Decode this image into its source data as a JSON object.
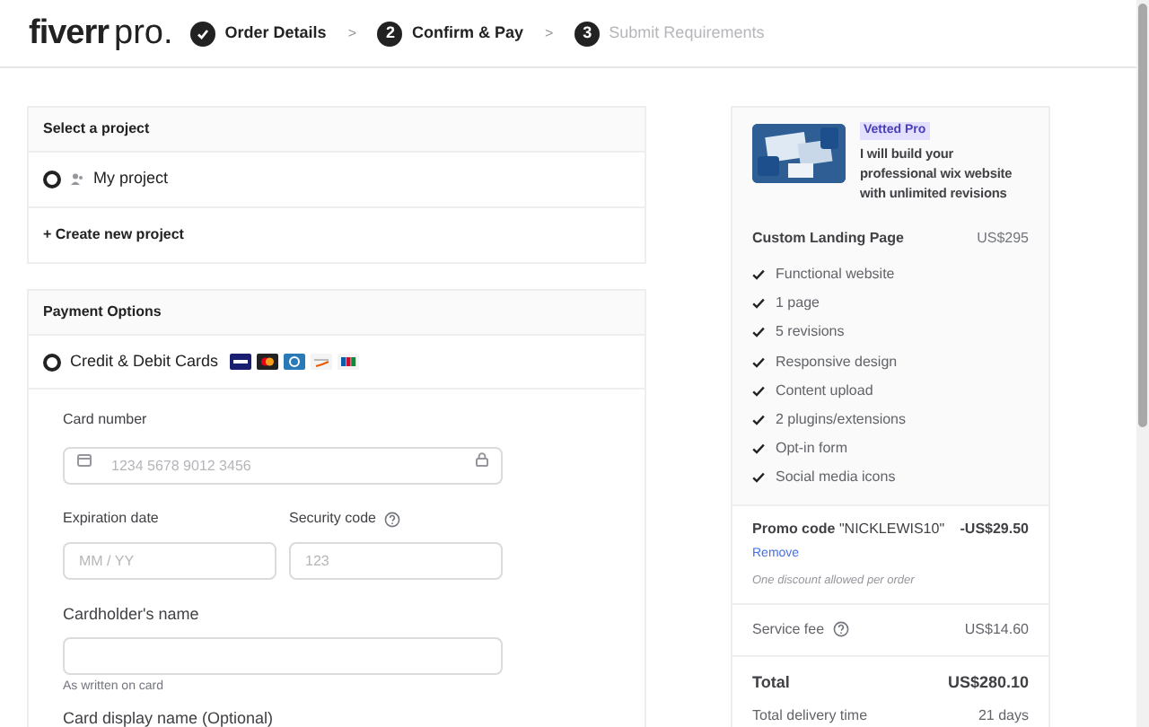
{
  "header": {
    "logo": "fiverr",
    "logo_suffix": "pro.",
    "steps": [
      {
        "label": "Order Details",
        "completed": true,
        "disabled": false
      },
      {
        "number": "2",
        "label": "Confirm & Pay",
        "completed": false,
        "disabled": false
      },
      {
        "number": "3",
        "label": "Submit Requirements",
        "completed": false,
        "disabled": true
      }
    ],
    "separator": ">"
  },
  "project": {
    "title": "Select a project",
    "options": [
      {
        "label": "My project",
        "selected": true
      }
    ],
    "create": "+ Create new project"
  },
  "payment": {
    "title": "Payment Options",
    "method": {
      "label": "Credit & Debit Cards",
      "selected": true
    },
    "fields": [
      {
        "kind": "card",
        "label": "Card number",
        "placeholder": "1234 5678 9012 3456"
      },
      {
        "kind": "pair",
        "items": [
          {
            "label": "Expiration date",
            "placeholder": "MM / YY",
            "help": false
          },
          {
            "label": "Security code",
            "placeholder": "123",
            "help": true
          }
        ]
      },
      {
        "kind": "text",
        "label": "Cardholder's name",
        "hint": "As written on card"
      },
      {
        "kind": "label",
        "label": "Card display name (Optional)"
      }
    ]
  },
  "summary": {
    "badge": "Vetted Pro",
    "gig_title": "I will build your professional wix website with unlimited revisions",
    "package": "Custom Landing Page",
    "price": "US$295",
    "features": [
      "Functional website",
      "1 page",
      "5 revisions",
      "Responsive design",
      "Content upload",
      "2 plugins/extensions",
      "Opt-in form",
      "Social media icons"
    ],
    "promo": {
      "label": "**Promo code** \"NICKLEWIS10\"",
      "amount": "-US$29.50",
      "remove": "Remove",
      "note": "One discount allowed per order"
    },
    "service_fee": {
      "label": "Service fee",
      "amount": "US$14.60"
    },
    "total": {
      "label": "Total",
      "amount": "US$280.10"
    },
    "delivery": {
      "label": "Total delivery time",
      "value": "21 days"
    }
  }
}
